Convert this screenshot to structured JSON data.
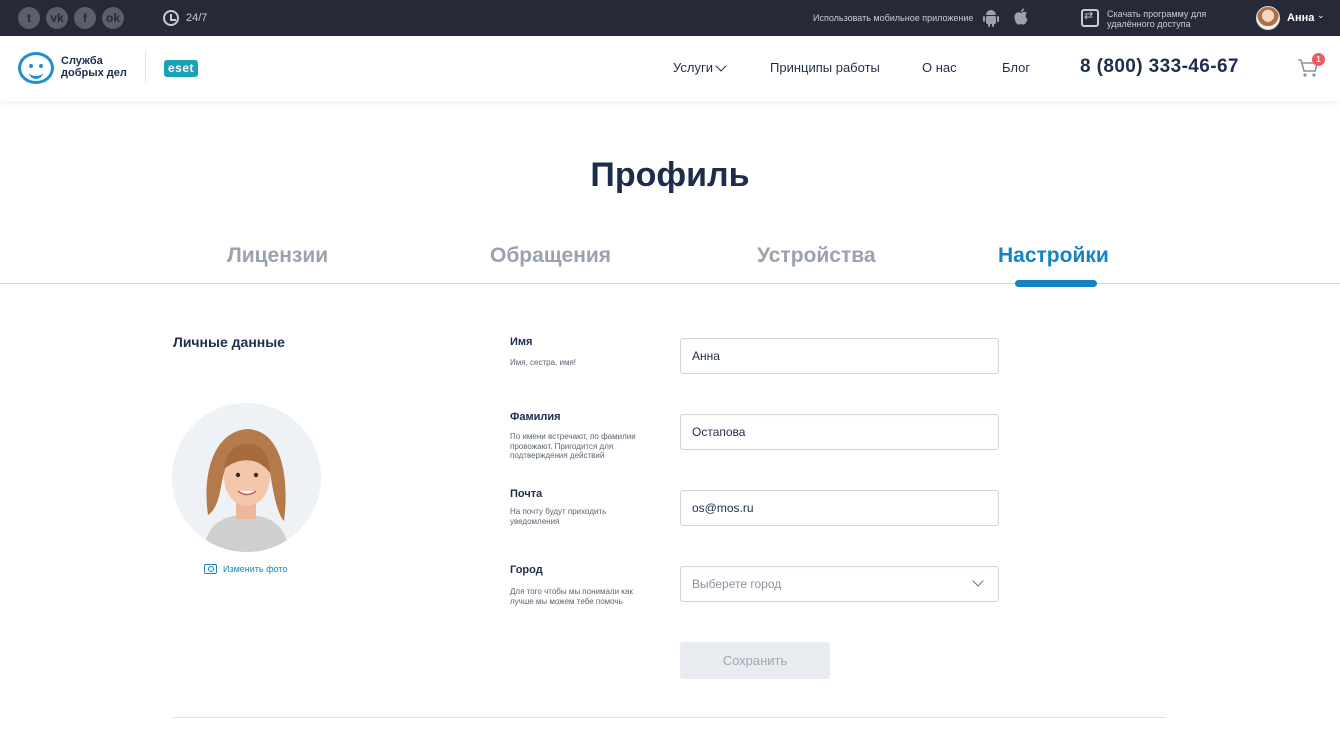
{
  "topbar": {
    "socials": [
      {
        "icon": "twitter-icon",
        "glyph": "t"
      },
      {
        "icon": "vk-icon",
        "glyph": "vk"
      },
      {
        "icon": "facebook-icon",
        "glyph": "f"
      },
      {
        "icon": "odnoklassniki-icon",
        "glyph": "ok"
      }
    ],
    "support_hours": "24/7",
    "mobile_app_text": "Использовать  мобильное приложение",
    "remote_text": "Скачать программу для удалённого доступа",
    "user_name": "Анна"
  },
  "header": {
    "logo_text": "Служба добрых дел",
    "partner_logo": "eset",
    "nav": {
      "services": "Услуги",
      "principles": "Принципы работы",
      "about": "О нас",
      "blog": "Блог"
    },
    "phone": "8 (800) 333-46-67",
    "cart_count": "1"
  },
  "page": {
    "title": "Профиль",
    "tabs": [
      "Лицензии",
      "Обращения",
      "Устройства",
      "Настройки"
    ],
    "active_tab": "Настройки"
  },
  "profile": {
    "section_title": "Личные данные",
    "change_photo": "Изменить фото"
  },
  "form": {
    "first_name": {
      "label": "Имя",
      "hint": "Имя, сестра, имя!",
      "value": "Анна"
    },
    "last_name": {
      "label": "Фамилия",
      "hint": "По имени встречают, по фамилии провожают. Пригодится для подтверждения действий",
      "value": "Остапова"
    },
    "email": {
      "label": "Почта",
      "hint": "На почту будут приходить уведомления",
      "value": "os@mos.ru"
    },
    "city": {
      "label": "Город",
      "hint": "Для того чтобы мы понимали как лучше мы можем тебе помочь",
      "placeholder": "Выберете город"
    },
    "save_label": "Сохранить"
  },
  "colors": {
    "topbar": "#262a38",
    "accent": "#1383c5",
    "text": "#1f2d4d",
    "inactive_tab": "#9aa2ae",
    "badge": "#f0595d"
  }
}
